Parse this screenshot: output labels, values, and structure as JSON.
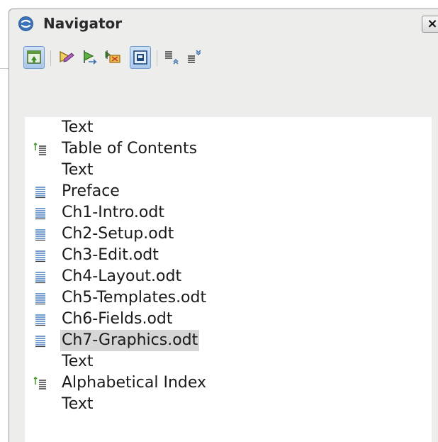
{
  "window": {
    "title": "Navigator",
    "close_symbol": "×"
  },
  "toolbar": {
    "buttons": [
      {
        "icon": "content-view-icon",
        "pressed": true
      },
      {
        "icon": "toggle-icon",
        "pressed": false
      },
      {
        "icon": "next-icon",
        "pressed": false
      },
      {
        "icon": "insert-icon",
        "pressed": false
      },
      {
        "icon": "content-navigation-icon",
        "pressed": true
      },
      {
        "icon": "promote-level-icon",
        "pressed": false
      },
      {
        "icon": "demote-level-icon",
        "pressed": false
      }
    ]
  },
  "tree": {
    "items": [
      {
        "label": "Text",
        "icon": "none"
      },
      {
        "label": "Table of Contents",
        "icon": "index-icon"
      },
      {
        "label": "Text",
        "icon": "none"
      },
      {
        "label": "Preface",
        "icon": "section-icon"
      },
      {
        "label": "Ch1-Intro.odt",
        "icon": "section-icon"
      },
      {
        "label": "Ch2-Setup.odt",
        "icon": "section-icon"
      },
      {
        "label": "Ch3-Edit.odt",
        "icon": "section-icon"
      },
      {
        "label": "Ch4-Layout.odt",
        "icon": "section-icon"
      },
      {
        "label": "Ch5-Templates.odt",
        "icon": "section-icon"
      },
      {
        "label": "Ch6-Fields.odt",
        "icon": "section-icon"
      },
      {
        "label": "Ch7-Graphics.odt",
        "icon": "section-icon",
        "selected": true
      },
      {
        "label": "Text",
        "icon": "none"
      },
      {
        "label": "Alphabetical Index",
        "icon": "index-icon"
      },
      {
        "label": "Text",
        "icon": "none"
      }
    ]
  },
  "colors": {
    "panel_bg": "#ededec",
    "tree_bg": "#ffffff",
    "selection_bg": "#d6d6d6",
    "pressed_button_bg": "#a9c8ec",
    "icon_blue": "#4a7fc0",
    "icon_green": "#4d9a2e"
  }
}
